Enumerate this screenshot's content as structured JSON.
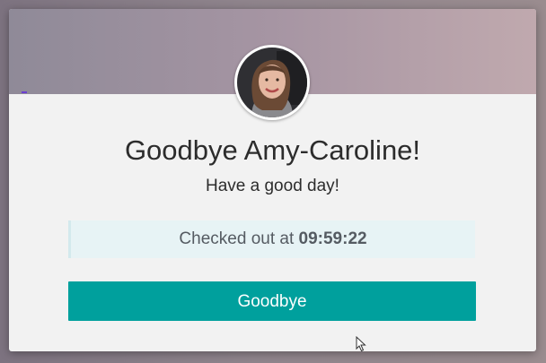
{
  "dialog": {
    "title": "Goodbye Amy-Caroline!",
    "subtitle": "Have a good day!",
    "checkout_prefix": "Checked out at ",
    "checkout_time": "09:59:22",
    "button_label": "Goodbye"
  },
  "colors": {
    "button": "#00a09d",
    "info_box": "#e7f3f5"
  },
  "icons": {
    "avatar": "user-photo",
    "cursor": "mouse-pointer-icon"
  }
}
